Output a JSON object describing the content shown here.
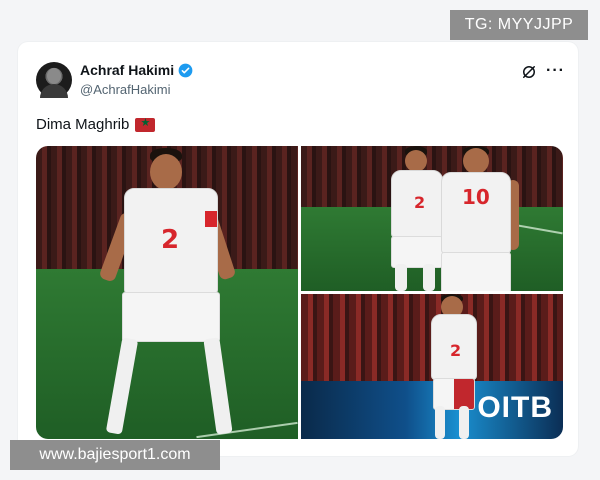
{
  "watermark_top": "TG: MYYJJPP",
  "watermark_bottom": "www.bajiesport1.com",
  "tweet": {
    "author": {
      "display_name": "Achraf Hakimi",
      "handle": "@AchrafHakimi",
      "verified": true
    },
    "text": "Dima Maghrib",
    "emoji": "morocco-flag-icon",
    "media": [
      {
        "shirt_number": "2"
      },
      {
        "shirt_numbers": [
          "2",
          "10"
        ]
      },
      {
        "shirt_number": "2",
        "ad_board": "OITB"
      }
    ]
  },
  "colors": {
    "verified": "#1d9bf0",
    "kit_red": "#d7262c",
    "flag_red": "#c1272d",
    "flag_green": "#006233"
  }
}
